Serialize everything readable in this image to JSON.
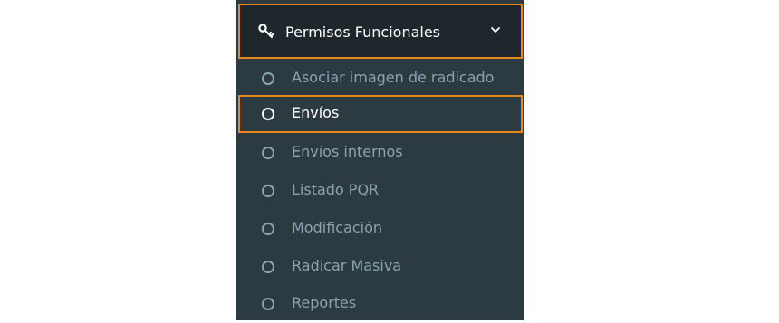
{
  "menu": {
    "header_label": "Permisos Funcionales",
    "header_icon": "key-icon",
    "toggle_icon": "chevron-down-icon",
    "items": [
      {
        "label": "Asociar imagen de radicado",
        "icon": "circle-icon",
        "active": false
      },
      {
        "label": "Envíos",
        "icon": "circle-icon",
        "active": true
      },
      {
        "label": "Envíos internos",
        "icon": "circle-icon",
        "active": false
      },
      {
        "label": "Listado PQR",
        "icon": "circle-icon",
        "active": false
      },
      {
        "label": "Modificación",
        "icon": "circle-icon",
        "active": false
      },
      {
        "label": "Radicar Masiva",
        "icon": "circle-icon",
        "active": false
      },
      {
        "label": "Reportes",
        "icon": "circle-icon",
        "active": false
      }
    ]
  },
  "colors": {
    "sidebar_bg": "#2c3b41",
    "header_bg": "#1e282c",
    "highlight_border": "#e8871e",
    "item_text": "#8aa4af",
    "active_text": "#ffffff"
  }
}
